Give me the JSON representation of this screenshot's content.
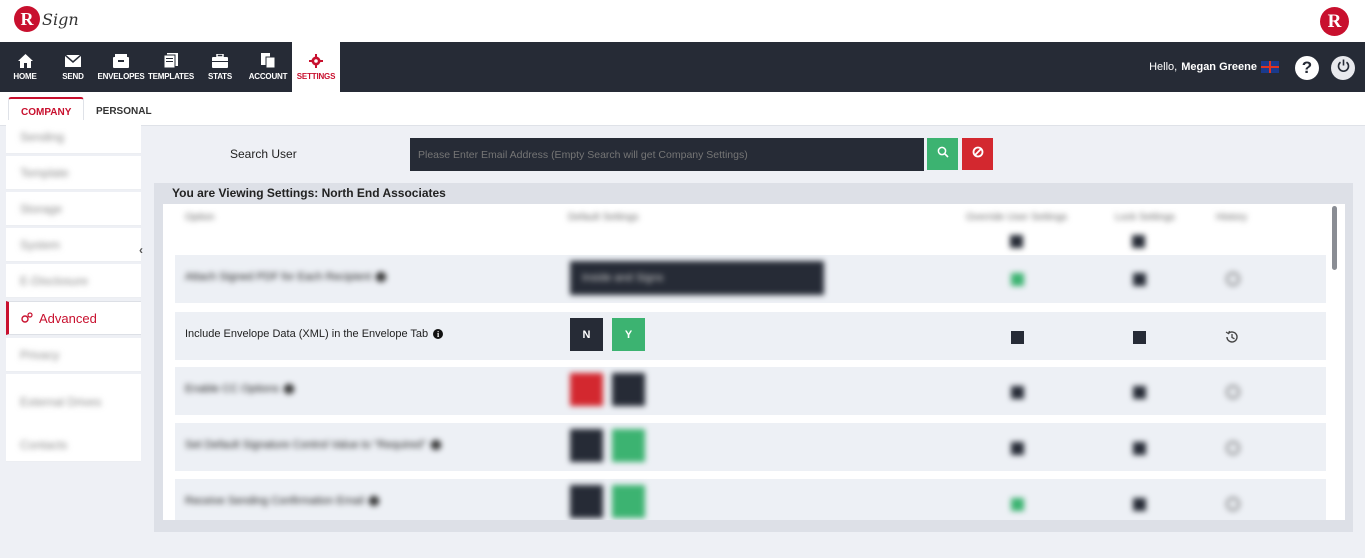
{
  "brand": {
    "logo_letter": "R",
    "logo_text": "Sign",
    "corner_logo_letter": "R"
  },
  "nav": {
    "items": [
      {
        "label": "HOME",
        "icon": "home-icon"
      },
      {
        "label": "SEND",
        "icon": "envelope-icon"
      },
      {
        "label": "ENVELOPES",
        "icon": "envelopes-icon"
      },
      {
        "label": "TEMPLATES",
        "icon": "templates-icon"
      },
      {
        "label": "STATS",
        "icon": "briefcase-icon"
      },
      {
        "label": "ACCOUNT",
        "icon": "account-icon"
      },
      {
        "label": "SETTINGS",
        "icon": "gear-icon",
        "active": true
      }
    ],
    "hello_text": "Hello,",
    "user_name": "Megan Greene",
    "help_glyph": "?"
  },
  "tabs": {
    "company": "COMPANY",
    "personal": "PERSONAL",
    "active": "company"
  },
  "sidebar": {
    "items": [
      {
        "label": "Sending",
        "blurred": true
      },
      {
        "label": "Template",
        "blurred": true
      },
      {
        "label": "Storage",
        "blurred": true
      },
      {
        "label": "System",
        "blurred": true
      },
      {
        "label": "E-Disclosure",
        "blurred": true
      },
      {
        "label": "Advanced",
        "active": true
      },
      {
        "label": "Privacy",
        "blurred": true
      },
      {
        "label": "External Drives",
        "blurred": true
      },
      {
        "label": "Contacts",
        "blurred": true
      }
    ],
    "collapse_glyph": "‹"
  },
  "search": {
    "label": "Search User",
    "placeholder": "Please Enter Email Address (Empty Search will get Company Settings)"
  },
  "panel": {
    "title": "You are Viewing Settings: North End Associates",
    "headers": {
      "option": "Option",
      "default": "Default Settings",
      "override": "Override User Settings",
      "lock": "Lock Settings",
      "history": "History"
    },
    "rows": [
      {
        "option": "Attach Signed PDF for Each Recipient",
        "blurred": true,
        "select_value": "Inside and Signs"
      },
      {
        "option": "Include Envelope Data (XML) in the Envelope Tab",
        "blurred": false,
        "n": "N",
        "y": "Y"
      },
      {
        "option": "Enable CC Options",
        "blurred": true
      },
      {
        "option": "Set Default Signature Control Value to \"Required\"",
        "blurred": true
      },
      {
        "option": "Receive Sending Confirmation Email",
        "blurred": true
      }
    ]
  },
  "colors": {
    "accent": "#c8102e",
    "dark": "#262b36",
    "green": "#3cb371",
    "red": "#d3282f"
  }
}
